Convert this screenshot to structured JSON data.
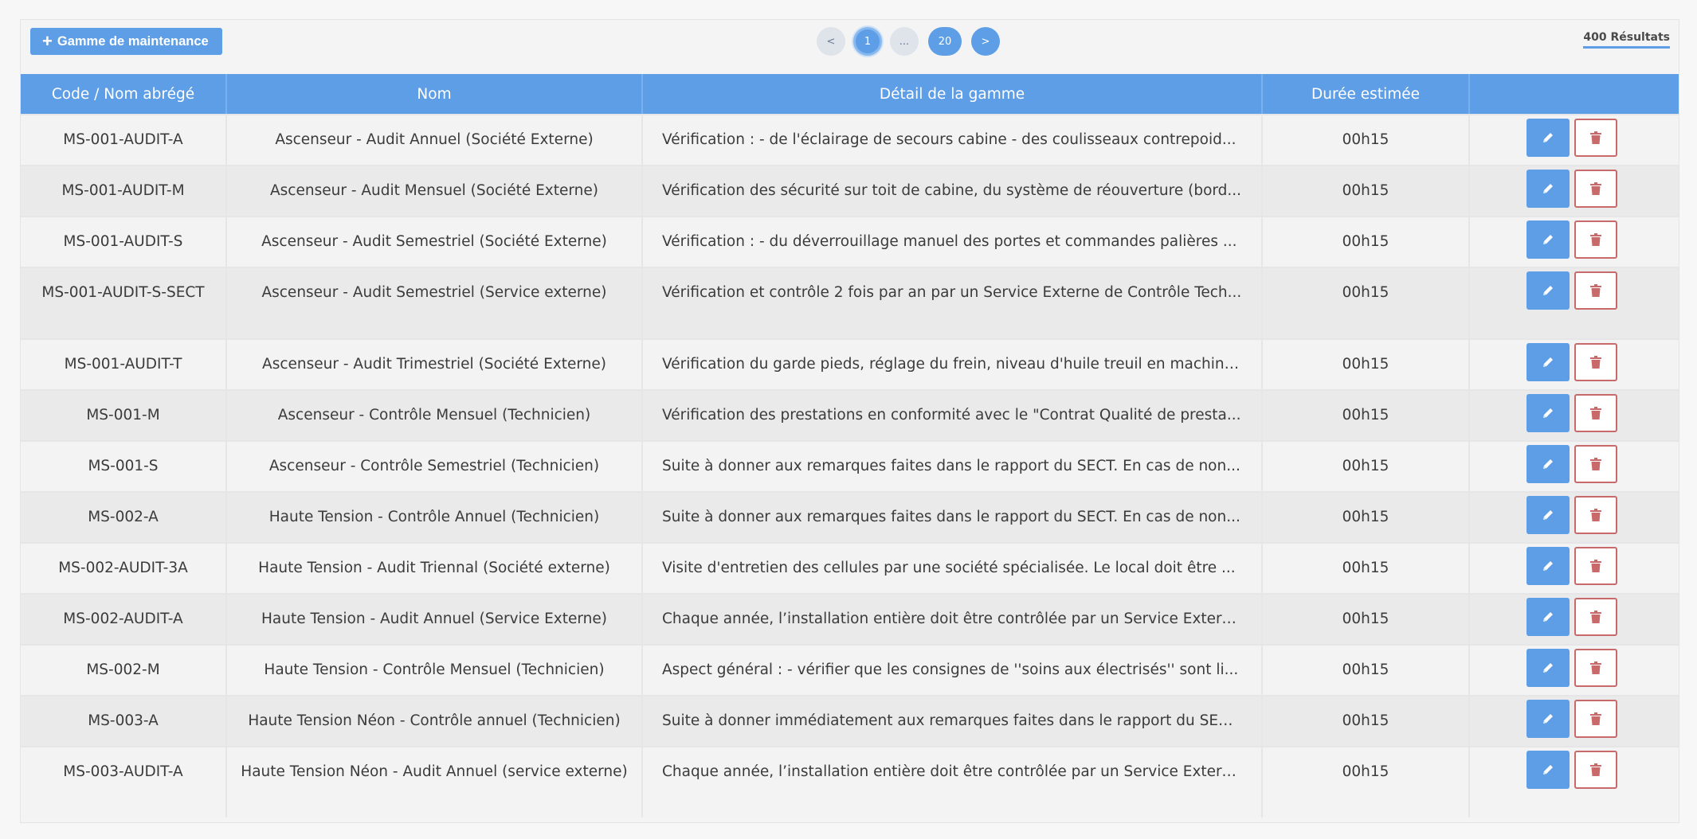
{
  "toolbar": {
    "add_label": "Gamme de maintenance",
    "results_label": "400 Résultats"
  },
  "pagination": {
    "prev": "<",
    "current": "1",
    "ellipsis": "...",
    "last": "20",
    "next": ">"
  },
  "table": {
    "headers": [
      "Code / Nom abrégé",
      "Nom",
      "Détail de la gamme",
      "Durée estimée",
      ""
    ],
    "rows": [
      {
        "code": "MS-001-AUDIT-A",
        "nom": "Ascenseur - Audit Annuel (Société Externe)",
        "detail": "Vérification : - de l'éclairage de secours cabine - des coulisseaux contrepoid...",
        "duree": "00h15"
      },
      {
        "code": "MS-001-AUDIT-M",
        "nom": "Ascenseur - Audit Mensuel (Société Externe)",
        "detail": "Vérification des sécurité sur toit de cabine, du système de réouverture (bord...",
        "duree": "00h15"
      },
      {
        "code": "MS-001-AUDIT-S",
        "nom": "Ascenseur - Audit Semestriel (Société Externe)",
        "detail": "Vérification : - du déverrouillage manuel des portes et commandes palières ...",
        "duree": "00h15"
      },
      {
        "code": "MS-001-AUDIT-S-SECT",
        "nom": "Ascenseur - Audit Semestriel (Service externe)",
        "detail": "Vérification et contrôle 2 fois par an par un Service Externe de Contrôle Tech...",
        "duree": "00h15"
      },
      {
        "code": "MS-001-AUDIT-T",
        "nom": "Ascenseur - Audit Trimestriel (Société Externe)",
        "detail": "Vérification du garde pieds, réglage du frein, niveau d'huile treuil en machine...",
        "duree": "00h15"
      },
      {
        "code": "MS-001-M",
        "nom": "Ascenseur - Contrôle Mensuel (Technicien)",
        "detail": "Vérification des prestations en conformité avec le \"Contrat Qualité de presta...",
        "duree": "00h15"
      },
      {
        "code": "MS-001-S",
        "nom": "Ascenseur - Contrôle Semestriel (Technicien)",
        "detail": "Suite à donner aux remarques faites dans le rapport du SECT. En cas de non...",
        "duree": "00h15"
      },
      {
        "code": "MS-002-A",
        "nom": "Haute Tension - Contrôle Annuel (Technicien)",
        "detail": "Suite à donner aux remarques faites dans le rapport du SECT. En cas de non...",
        "duree": "00h15"
      },
      {
        "code": "MS-002-AUDIT-3A",
        "nom": "Haute Tension - Audit Triennal (Société externe)",
        "detail": "Visite d'entretien des cellules par une société spécialisée. Le local doit être ...",
        "duree": "00h15"
      },
      {
        "code": "MS-002-AUDIT-A",
        "nom": "Haute Tension - Audit Annuel (Service Externe)",
        "detail": "Chaque année, l’installation entière doit être contrôlée par un Service Extern...",
        "duree": "00h15"
      },
      {
        "code": "MS-002-M",
        "nom": "Haute Tension - Contrôle Mensuel (Technicien)",
        "detail": "Aspect général : - vérifier que les consignes de ''soins aux électrisés'' sont li...",
        "duree": "00h15"
      },
      {
        "code": "MS-003-A",
        "nom": "Haute Tension Néon - Contrôle annuel (Technicien)",
        "detail": "Suite à donner immédiatement aux remarques faites dans le rapport du SEC...",
        "duree": "00h15"
      },
      {
        "code": "MS-003-AUDIT-A",
        "nom": "Haute Tension Néon - Audit Annuel (service externe)",
        "detail": "Chaque année, l’installation entière doit être contrôlée par un Service Extern...",
        "duree": "00h15"
      }
    ]
  },
  "icons": {
    "edit": "pencil-icon",
    "delete": "trash-icon",
    "add": "plus-icon"
  },
  "colors": {
    "primary": "#5d9ee6",
    "danger": "#c96a6a"
  }
}
